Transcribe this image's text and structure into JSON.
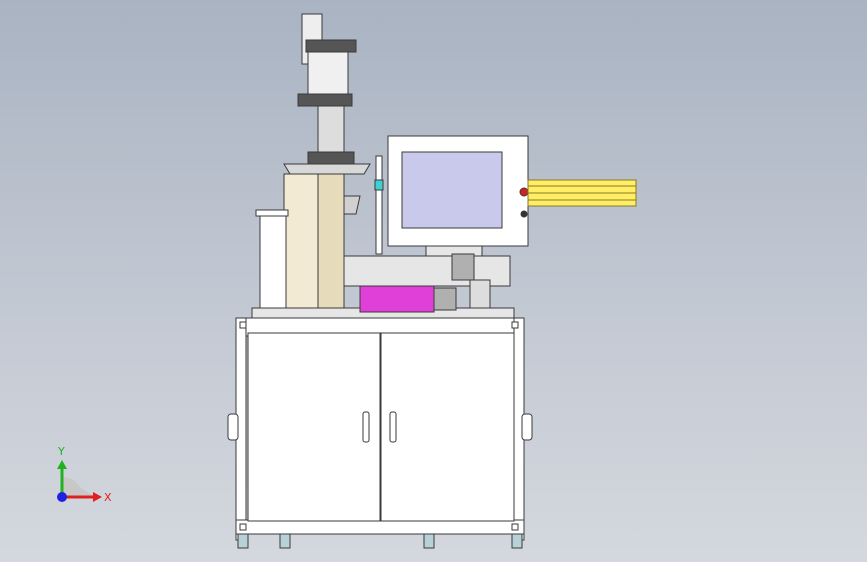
{
  "colors": {
    "background_top": "#a9b3c2",
    "background_bottom": "#d4d8de",
    "frame": "#ffffff",
    "outline": "#3a3a3a",
    "motor": "#e040d8",
    "light_curtain": "#ffee66",
    "screen": "#c9c9ec",
    "stop_button": "#d42020",
    "axis_x": "#e02020",
    "axis_y": "#20b020",
    "axis_z": "#2020e0"
  },
  "triad": {
    "x_label": "X",
    "y_label": "Y"
  }
}
